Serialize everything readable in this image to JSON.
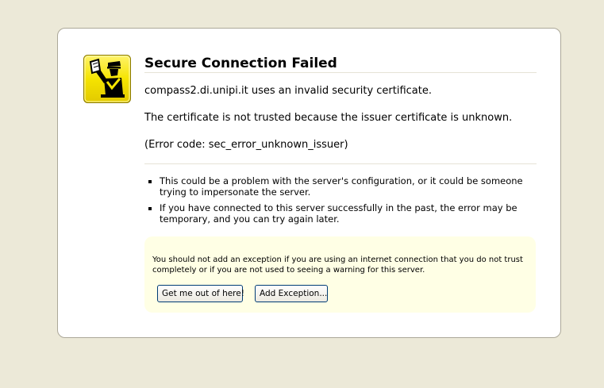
{
  "error_page": {
    "title": "Secure Connection Failed",
    "message_host": "compass2.di.unipi.it uses an invalid security certificate.",
    "message_reason": "The certificate is not trusted because the issuer certificate is unknown.",
    "message_code": "(Error code: sec_error_unknown_issuer)",
    "bullets": [
      "This could be a problem with the server's configuration, or it could be someone trying to impersonate the server.",
      "If you have connected to this server successfully in the past, the error may be temporary, and you can try again later."
    ],
    "warning": {
      "text": "You should not add an exception if you are using an internet connection that you do not trust completely or if you are not used to seeing a warning for this server.",
      "get_me_out_label": "Get me out of here!",
      "add_exception_label": "Add Exception..."
    },
    "icon": "security-officer-shield-icon"
  },
  "colors": {
    "page_background": "#ece9d8",
    "box_background": "#ffffff",
    "box_border": "#aca899",
    "warning_background": "#ffffe5",
    "icon_yellow": "#f7e700",
    "button_border": "#003c74"
  }
}
